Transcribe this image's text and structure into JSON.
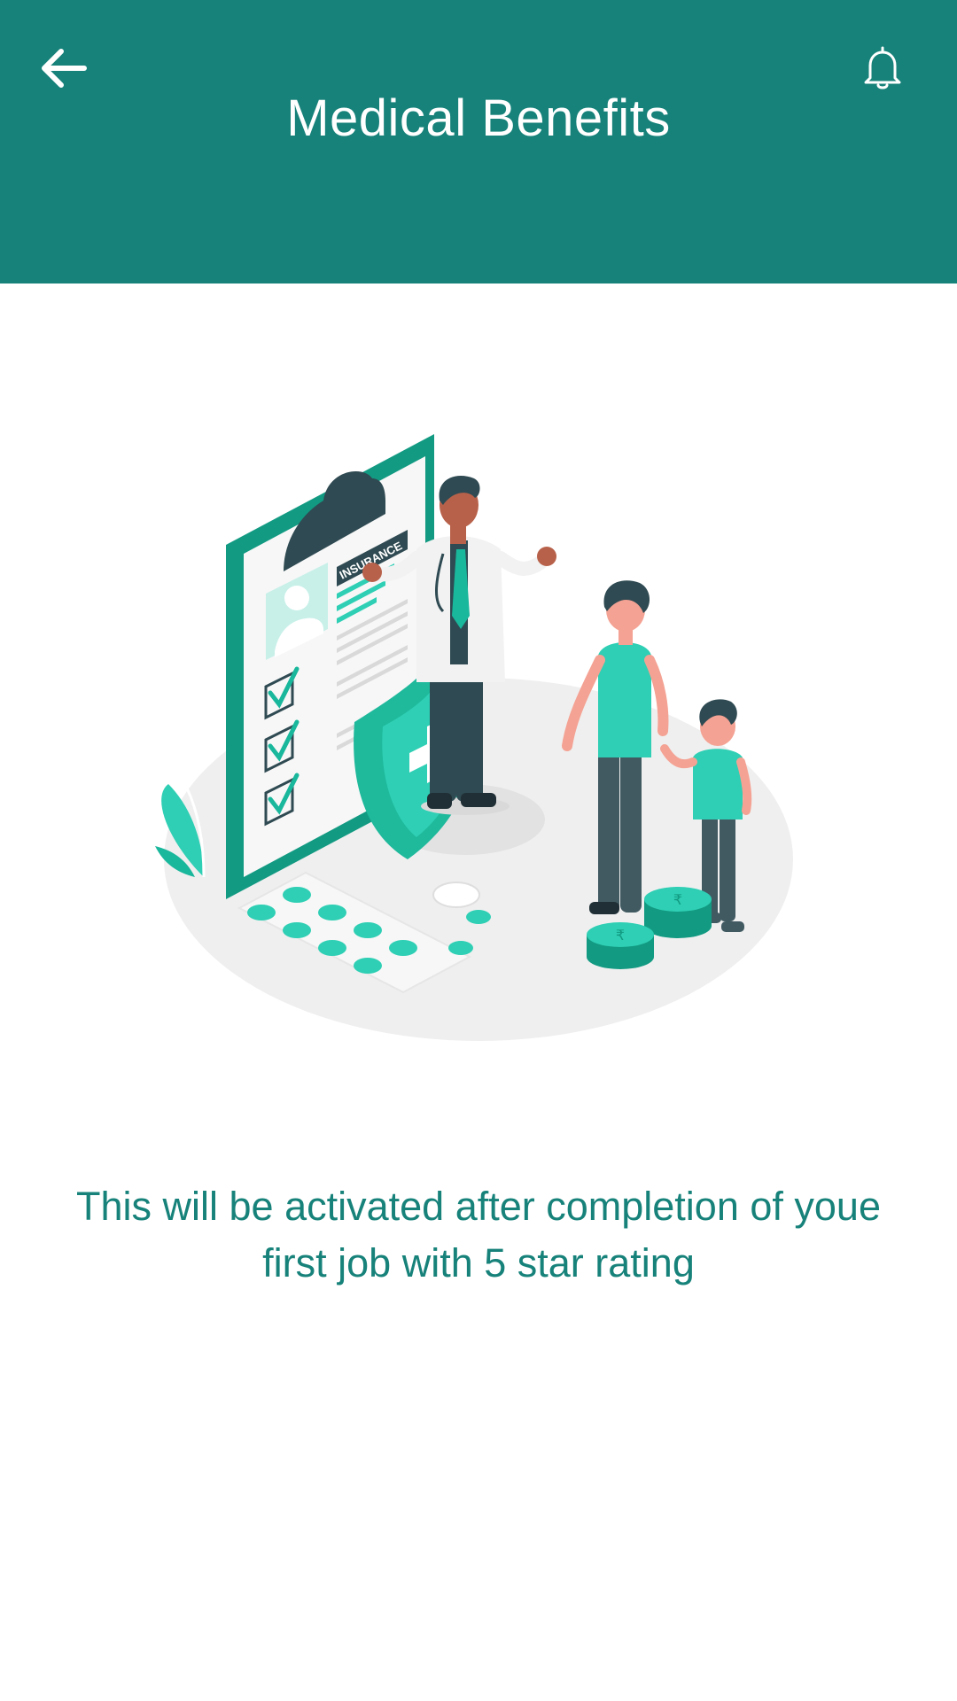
{
  "header": {
    "title": "Medical Benefits",
    "back_icon": "arrow-left-icon",
    "notification_icon": "bell-icon",
    "background_color": "#17827a"
  },
  "illustration": {
    "badge_text": "INSURANCE",
    "coin_symbol": "₹"
  },
  "main": {
    "message": "This will be activated after completion of youe first job with 5 star rating",
    "text_color": "#17827a"
  }
}
